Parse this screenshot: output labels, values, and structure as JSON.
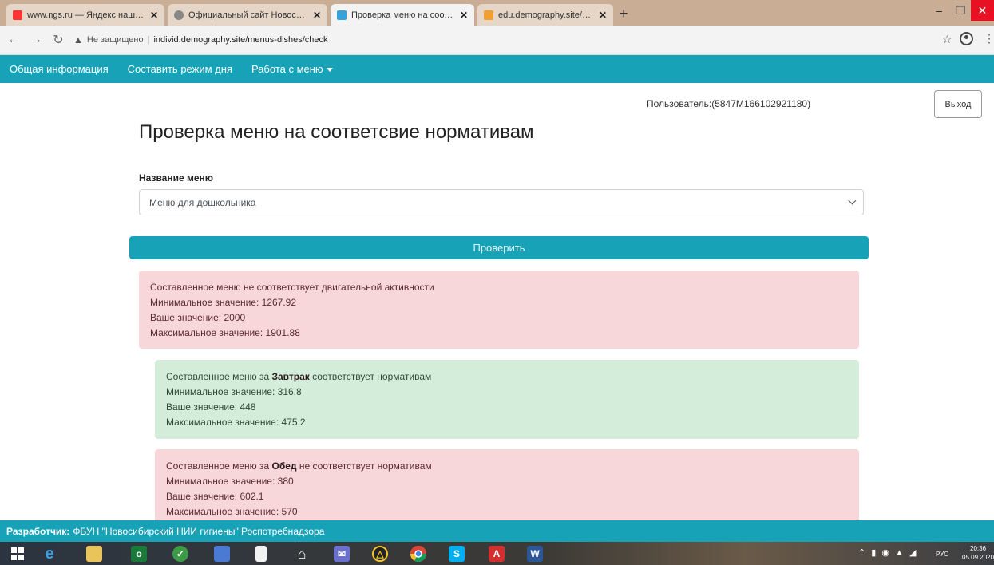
{
  "browser": {
    "tabs": [
      {
        "title": "www.ngs.ru — Яндекс нашлось",
        "favicon_color": "#f33",
        "active": false
      },
      {
        "title": "Официальный сайт Новосибирс",
        "favicon_color": "#888",
        "active": false
      },
      {
        "title": "Проверка меню на соответсвие",
        "favicon_color": "#3aa0d8",
        "active": true
      },
      {
        "title": "edu.demography.site/semmey/t",
        "favicon_color": "#f0a030",
        "active": false
      }
    ],
    "new_tab": "+",
    "window_controls": {
      "minimize": "–",
      "maximize": "❐",
      "close": "✕"
    },
    "address": {
      "security_warning": "Не защищено",
      "url": "individ.demography.site/menus-dishes/check"
    }
  },
  "navbar": {
    "items": [
      "Общая информация",
      "Составить режим дня",
      "Работа с меню"
    ]
  },
  "header": {
    "user_text": "Пользователь:(5847М166102921180)",
    "logout_label": "Выход"
  },
  "page": {
    "title": "Проверка меню на соответсвие нормативам",
    "menu_label": "Название меню",
    "menu_value": "Меню для дошкольника",
    "check_button": "Проверить"
  },
  "alerts": {
    "main": {
      "line1": "Составленное меню не соответствует двигательной активности",
      "line2": "Минимальное значение: 1267.92",
      "line3": "Ваше значение: 2000",
      "line4": "Максимальное значение: 1901.88"
    },
    "breakfast": {
      "prefix": "Составленное меню за ",
      "meal": "Завтрак",
      "suffix": " соответствует нормативам",
      "line2": "Минимальное значение: 316.8",
      "line3": "Ваше значение: 448",
      "line4": "Максимальное значение: 475.2"
    },
    "lunch": {
      "prefix": "Составленное меню за ",
      "meal": "Обед",
      "suffix": " не соответствует нормативам",
      "line2": "Минимальное значение: 380",
      "line3": "Ваше значение: 602.1",
      "line4": "Максимальное значение: 570"
    }
  },
  "footer": {
    "label": "Разработчик:",
    "text": "ФБУН \"Новосибирский НИИ гигиены\" Роспотребнадзора"
  },
  "taskbar": {
    "language": "РУС",
    "time": "20:36",
    "date": "05.09.2020"
  },
  "colors": {
    "primary": "#17a2b8",
    "danger_bg": "#f8d7da",
    "success_bg": "#d4edda"
  }
}
